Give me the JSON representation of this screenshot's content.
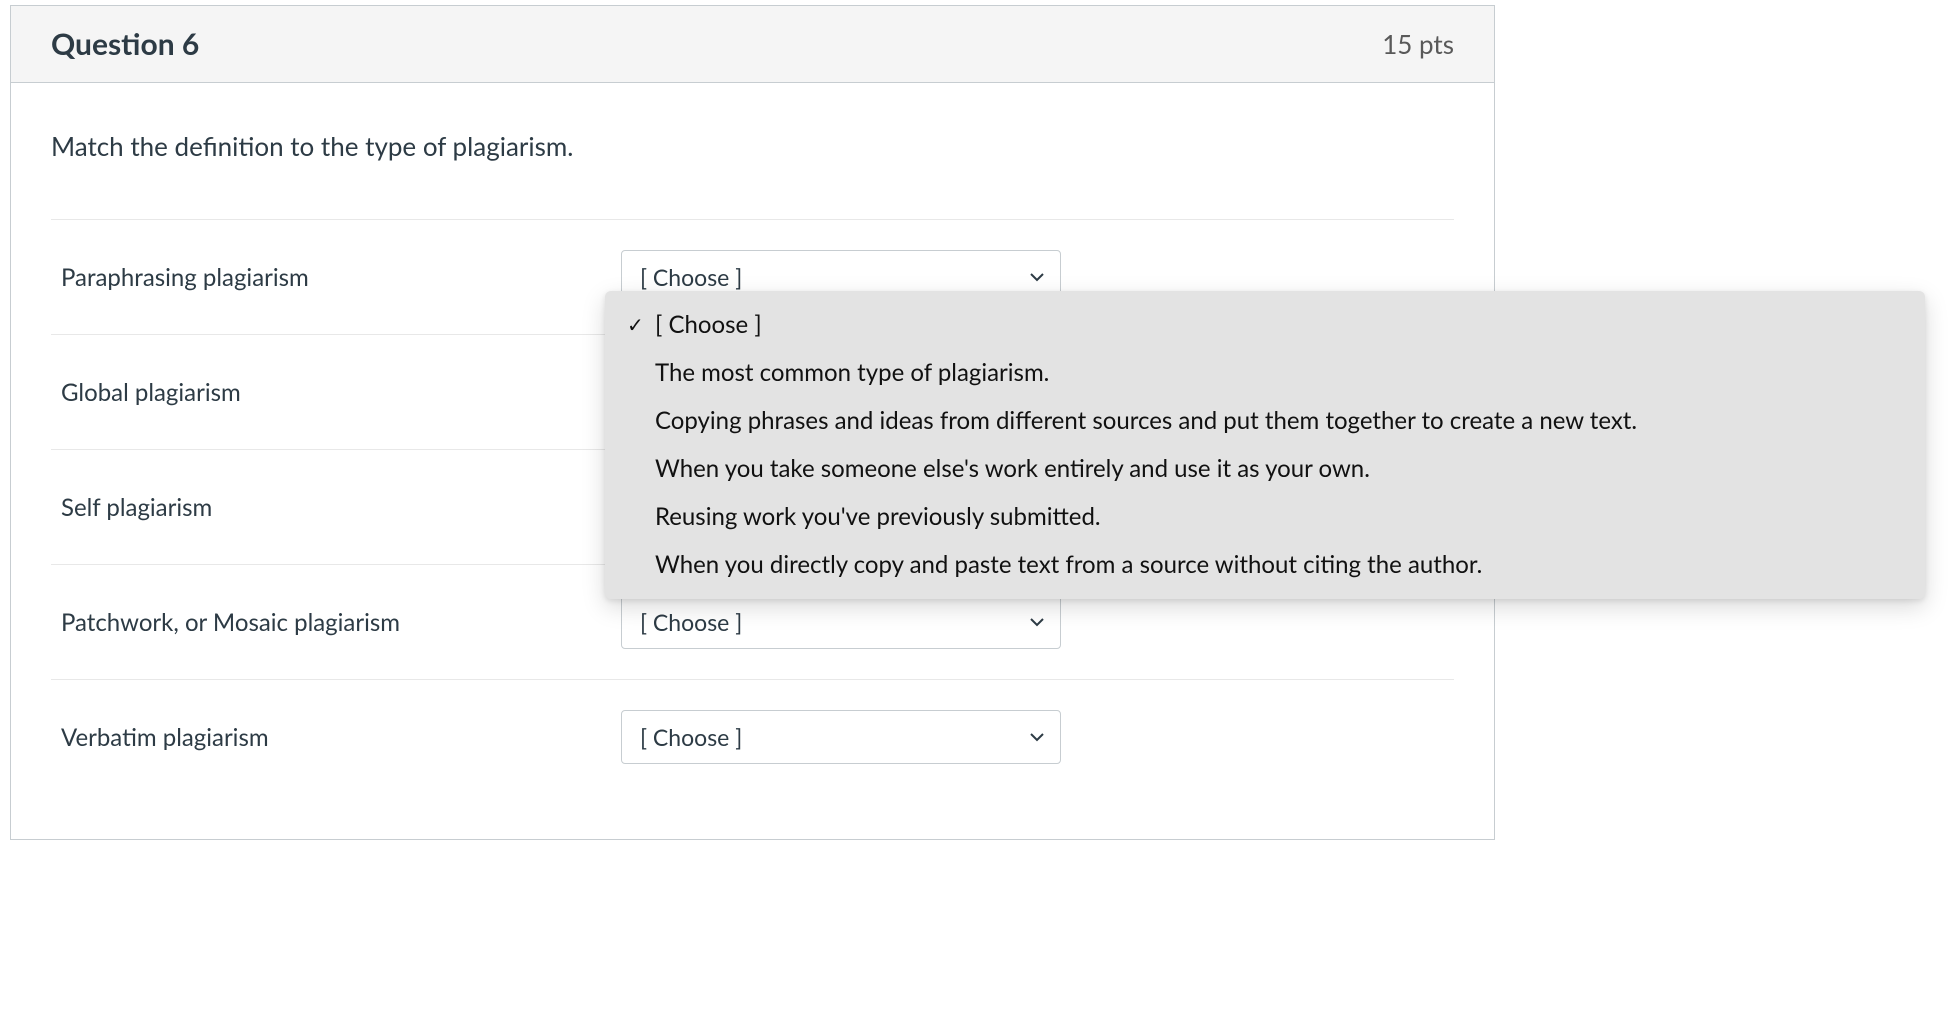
{
  "question": {
    "title": "Question 6",
    "points": "15 pts",
    "prompt": "Match the definition to the type of plagiarism."
  },
  "choose_placeholder": "[ Choose ]",
  "rows": [
    {
      "label": "Paraphrasing plagiarism"
    },
    {
      "label": "Global plagiarism"
    },
    {
      "label": "Self plagiarism"
    },
    {
      "label": "Patchwork, or Mosaic plagiarism"
    },
    {
      "label": "Verbatim plagiarism"
    }
  ],
  "dropdown": {
    "open_for_row": 0,
    "options": [
      {
        "text": "[ Choose ]",
        "selected": true
      },
      {
        "text": "The most common type of plagiarism.",
        "selected": false
      },
      {
        "text": "Copying phrases and ideas from different sources and put them together to create a new text.",
        "selected": false
      },
      {
        "text": "When you take someone else's work entirely and use it as your own.",
        "selected": false
      },
      {
        "text": "Reusing work you've previously submitted.",
        "selected": false
      },
      {
        "text": "When you directly copy and paste text from a source without citing the author.",
        "selected": false
      }
    ]
  }
}
